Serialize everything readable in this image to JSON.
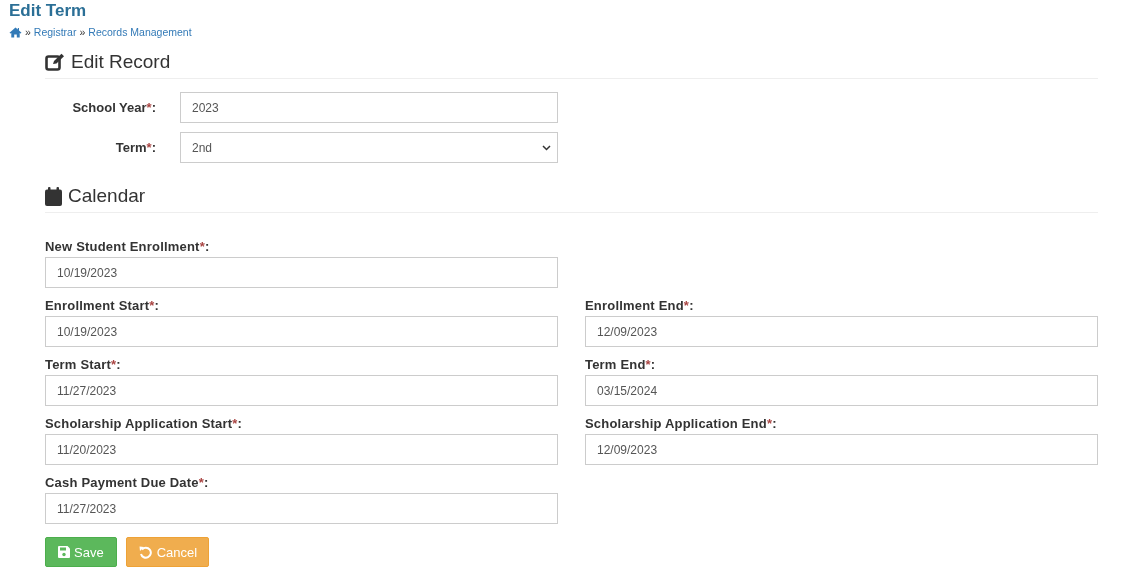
{
  "page": {
    "title": "Edit Term"
  },
  "breadcrumb": [
    {
      "label": "Registrar"
    },
    {
      "label": "Records Management"
    }
  ],
  "breadcrumb_separator": "»",
  "record_section": {
    "heading": "Edit Record",
    "fields": [
      {
        "kind": "text",
        "label": "School Year",
        "mark": "*",
        "suffix": ":",
        "value": "2023"
      },
      {
        "kind": "select",
        "label": "Term",
        "mark": "*",
        "suffix": ":",
        "value": "2nd"
      }
    ]
  },
  "calendar_section": {
    "heading": "Calendar",
    "rows": [
      [
        {
          "label": "New Student Enrollment",
          "mark": "*",
          "suffix": ":",
          "value": "10/19/2023"
        }
      ],
      [
        {
          "label": "Enrollment Start",
          "mark": "*",
          "suffix": ":",
          "value": "10/19/2023"
        },
        {
          "label": "Enrollment End",
          "mark": "*",
          "suffix": ":",
          "value": "12/09/2023"
        }
      ],
      [
        {
          "label": "Term Start",
          "mark": "*",
          "suffix": ":",
          "value": "11/27/2023"
        },
        {
          "label": "Term End",
          "mark": "*",
          "suffix": ":",
          "value": "03/15/2024"
        }
      ],
      [
        {
          "label": "Scholarship Application Start",
          "mark": "*",
          "suffix": ":",
          "value": "11/20/2023"
        },
        {
          "label": "Scholarship Application End",
          "mark": "*",
          "suffix": ":",
          "value": "12/09/2023"
        }
      ],
      [
        {
          "label": "Cash Payment Due Date",
          "mark": "*",
          "suffix": ":",
          "value": "11/27/2023"
        }
      ]
    ]
  },
  "buttons": [
    {
      "kind": "save",
      "label": "Save"
    },
    {
      "kind": "cancel",
      "label": "Cancel"
    }
  ]
}
